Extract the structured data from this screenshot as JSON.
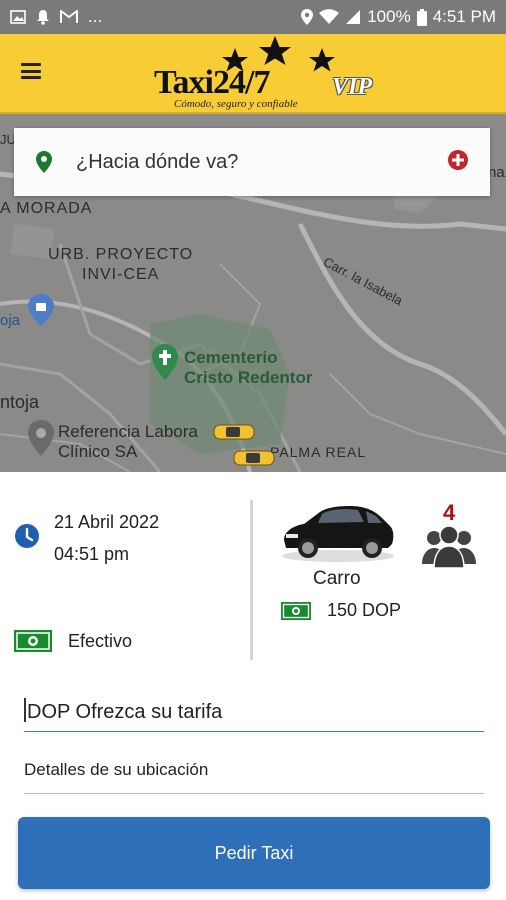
{
  "statusbar": {
    "left_icons": [
      "image-icon",
      "bell-icon",
      "gmail-icon"
    ],
    "more": "...",
    "battery": "100%",
    "time": "4:51 PM"
  },
  "header": {
    "logo_title": "Taxi24/7",
    "logo_vip": "VIP",
    "logo_tagline": "Cómodo, seguro y confiable",
    "background": "#f7cc35"
  },
  "map": {
    "labels": {
      "ju": "JU",
      "morada": "A MORADA",
      "urb1": "URB. PROYECTO",
      "urb2": "INVI-CEA",
      "calle": "Carr. la Isabela",
      "oja": "oja",
      "cem1": "Cementerio",
      "cem2": "Cristo Redentor",
      "ntoja": "ntoja",
      "ref1": "Referencia Labora",
      "ref2": "Clínico SA",
      "palma": "PALMA REAL",
      "na": "na"
    }
  },
  "search": {
    "placeholder": "¿Hacia dónde va?"
  },
  "trip": {
    "date": "21 Abril 2022",
    "time": "04:51 pm",
    "payment": "Efectivo",
    "vehicle": "Carro",
    "price": "150 DOP",
    "passengers": "4"
  },
  "form": {
    "fare_placeholder": "DOP Ofrezca su tarifa",
    "details_placeholder": "Detalles de su ubicación",
    "submit_label": "Pedir Taxi"
  },
  "colors": {
    "accent": "#2e6fba",
    "passenger_count": "#a3121a",
    "money_green": "#1a8a2e"
  }
}
